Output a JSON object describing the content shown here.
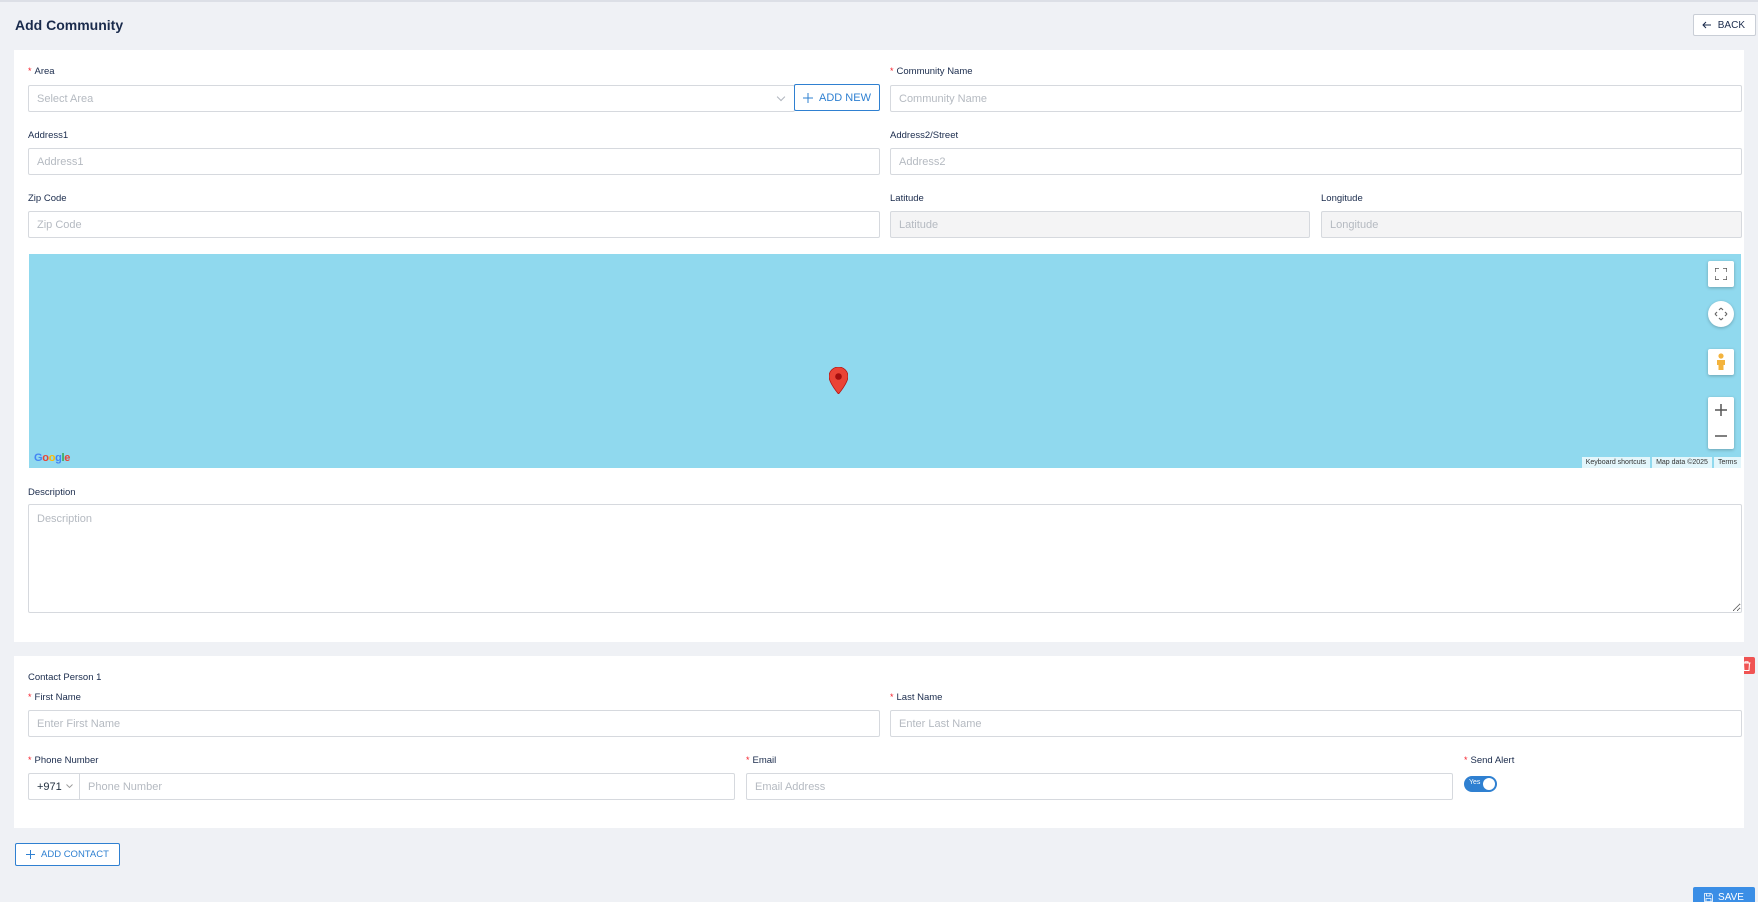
{
  "page": {
    "title": "Add Community",
    "back_label": "BACK"
  },
  "form": {
    "area": {
      "label": "Area",
      "placeholder": "Select Area",
      "add_new_label": "ADD NEW"
    },
    "community_name": {
      "label": "Community Name",
      "placeholder": "Community Name"
    },
    "address1": {
      "label": "Address1",
      "placeholder": "Address1"
    },
    "address2": {
      "label": "Address2/Street",
      "placeholder": "Address2"
    },
    "zip": {
      "label": "Zip Code",
      "placeholder": "Zip Code"
    },
    "latitude": {
      "label": "Latitude",
      "placeholder": "Latitude"
    },
    "longitude": {
      "label": "Longitude",
      "placeholder": "Longitude"
    },
    "description": {
      "label": "Description",
      "placeholder": "Description"
    }
  },
  "map": {
    "footer": [
      "Keyboard shortcuts",
      "Map data ©2025",
      "Terms"
    ],
    "water_color": "#90d9ee",
    "marker_color": "#ea4335"
  },
  "contact": {
    "title": "Contact Person 1",
    "first_name": {
      "label": "First Name",
      "placeholder": "Enter First Name"
    },
    "last_name": {
      "label": "Last Name",
      "placeholder": "Enter Last Name"
    },
    "phone": {
      "label": "Phone Number",
      "prefix": "+971",
      "placeholder": "Phone Number"
    },
    "email": {
      "label": "Email",
      "placeholder": "Email Address"
    },
    "send_alert": {
      "label": "Send Alert",
      "value": "Yes"
    }
  },
  "actions": {
    "add_contact_label": "ADD CONTACT",
    "save_label": "SAVE"
  },
  "colors": {
    "primary": "#2f80d1",
    "danger": "#f05353",
    "required": "#f5222d"
  }
}
